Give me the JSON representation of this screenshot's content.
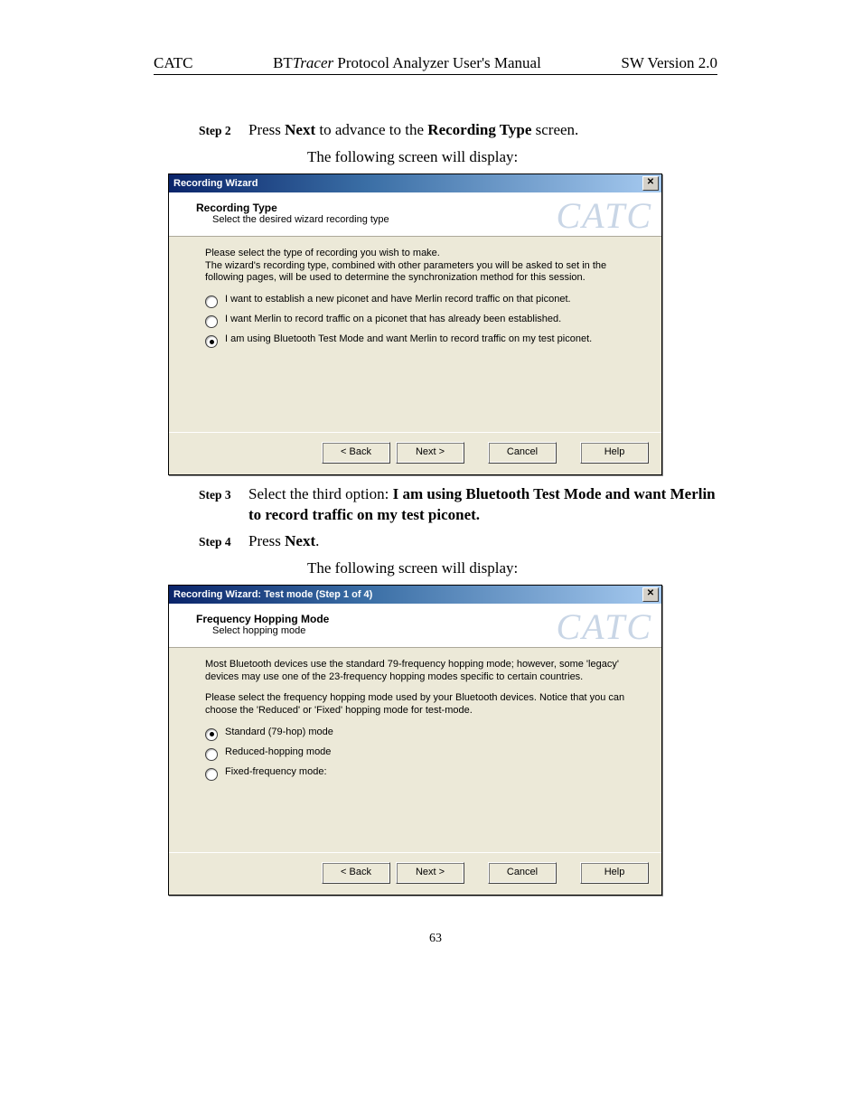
{
  "header": {
    "left": "CATC",
    "center_prefix": "BT",
    "center_italic": "Tracer",
    "center_suffix": " Protocol Analyzer User's Manual",
    "right": "SW Version 2.0"
  },
  "steps": {
    "s2": {
      "label": "Step 2",
      "t1": "Press ",
      "b1": "Next",
      "t2": " to advance to the ",
      "b2": "Recording Type",
      "t3": " screen."
    },
    "caption1": "The following screen will display:",
    "s3": {
      "label": "Step 3",
      "t1": "Select the third option:  ",
      "b1": "I am using Bluetooth Test Mode and want Merlin to record traffic on my test piconet."
    },
    "s4": {
      "label": "Step 4",
      "t1": "Press ",
      "b1": "Next",
      "t2": "."
    },
    "caption2": "The following screen will display:"
  },
  "dialog1": {
    "title": "Recording Wizard",
    "header_title": "Recording Type",
    "header_sub": "Select the desired wizard recording type",
    "watermark": "CATC",
    "para1": "Please select the type of recording you wish to make.\nThe wizard's recording type, combined with other parameters you will be asked to set in the following pages, will be used to determine the synchronization method for this session.",
    "opt1": "I want to establish a new piconet and have Merlin record traffic on that piconet.",
    "opt2": "I want Merlin to record traffic on a piconet that has already been established.",
    "opt3": "I am using Bluetooth Test Mode and want Merlin to record traffic on my test piconet.",
    "back": "< Back",
    "next": "Next >",
    "cancel": "Cancel",
    "help": "Help"
  },
  "dialog2": {
    "title": "Recording Wizard: Test mode (Step 1 of 4)",
    "header_title": "Frequency Hopping Mode",
    "header_sub": "Select hopping mode",
    "watermark": "CATC",
    "para1": "Most Bluetooth devices use the standard 79-frequency hopping mode; however, some 'legacy' devices may use one of the 23-frequency hopping modes specific to certain countries.",
    "para2": "Please select the frequency hopping mode used by your Bluetooth devices. Notice that you can choose the 'Reduced' or 'Fixed' hopping mode for test-mode.",
    "opt1": "Standard (79-hop) mode",
    "opt2": "Reduced-hopping mode",
    "opt3": "Fixed-frequency mode:",
    "back": "< Back",
    "next": "Next >",
    "cancel": "Cancel",
    "help": "Help"
  },
  "page_number": "63"
}
